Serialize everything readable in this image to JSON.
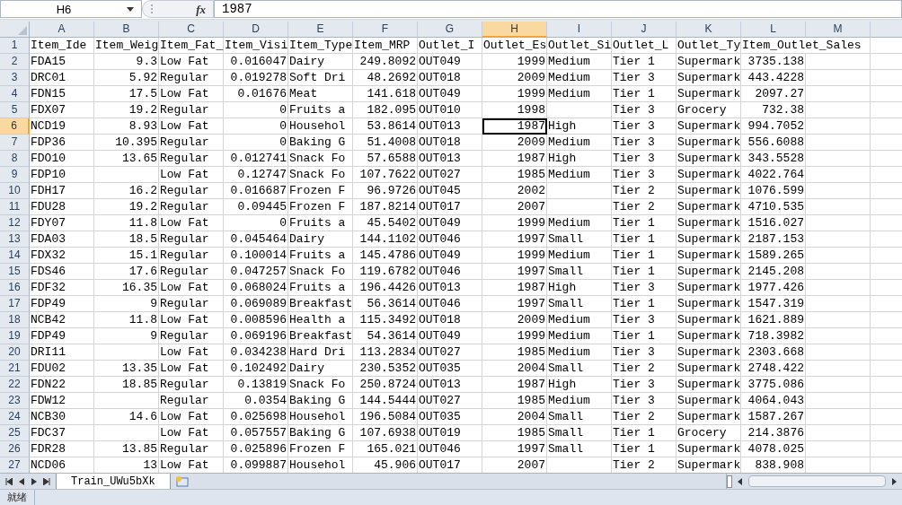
{
  "formula_bar": {
    "name_box": "H6",
    "function_label": "fx",
    "formula": "1987"
  },
  "columns": [
    {
      "letter": "A",
      "selected": false
    },
    {
      "letter": "B",
      "selected": false
    },
    {
      "letter": "C",
      "selected": false
    },
    {
      "letter": "D",
      "selected": false
    },
    {
      "letter": "E",
      "selected": false
    },
    {
      "letter": "F",
      "selected": false
    },
    {
      "letter": "G",
      "selected": false
    },
    {
      "letter": "H",
      "selected": true
    },
    {
      "letter": "I",
      "selected": false
    },
    {
      "letter": "J",
      "selected": false
    },
    {
      "letter": "K",
      "selected": false
    },
    {
      "letter": "L",
      "selected": false
    },
    {
      "letter": "M",
      "selected": false
    }
  ],
  "rows": [
    {
      "number": "1",
      "kind": "header",
      "selected": false,
      "cells": [
        "Item_Ide",
        "Item_Weig",
        "Item_Fat_",
        "Item_Visi",
        "Item_Type",
        "Item_MRP",
        "Outlet_I",
        "Outlet_Es",
        "Outlet_Si",
        "Outlet_L",
        "Outlet_Ty",
        "Item_Outlet_Sales",
        null
      ]
    },
    {
      "number": "2",
      "kind": "data",
      "selected": false,
      "cells": [
        "FDA15",
        "9.3",
        "Low Fat",
        "0.016047",
        "Dairy",
        "249.8092",
        "OUT049",
        "1999",
        "Medium",
        "Tier 1",
        "Supermark",
        "3735.138",
        null
      ]
    },
    {
      "number": "3",
      "kind": "data",
      "selected": false,
      "cells": [
        "DRC01",
        "5.92",
        "Regular",
        "0.019278",
        "Soft Dri",
        "48.2692",
        "OUT018",
        "2009",
        "Medium",
        "Tier 3",
        "Supermark",
        "443.4228",
        null
      ]
    },
    {
      "number": "4",
      "kind": "data",
      "selected": false,
      "cells": [
        "FDN15",
        "17.5",
        "Low Fat",
        "0.01676",
        "Meat",
        "141.618",
        "OUT049",
        "1999",
        "Medium",
        "Tier 1",
        "Supermark",
        "2097.27",
        null
      ]
    },
    {
      "number": "5",
      "kind": "data",
      "selected": false,
      "cells": [
        "FDX07",
        "19.2",
        "Regular",
        "0",
        "Fruits a",
        "182.095",
        "OUT010",
        "1998",
        null,
        "Tier 3",
        "Grocery",
        "732.38",
        null
      ]
    },
    {
      "number": "6",
      "kind": "data",
      "selected": true,
      "cells": [
        "NCD19",
        "8.93",
        "Low Fat",
        "0",
        "Househol",
        "53.8614",
        "OUT013",
        "1987",
        "High",
        "Tier 3",
        "Supermark",
        "994.7052",
        null
      ]
    },
    {
      "number": "7",
      "kind": "data",
      "selected": false,
      "cells": [
        "FDP36",
        "10.395",
        "Regular",
        "0",
        "Baking G",
        "51.4008",
        "OUT018",
        "2009",
        "Medium",
        "Tier 3",
        "Supermark",
        "556.6088",
        null
      ]
    },
    {
      "number": "8",
      "kind": "data",
      "selected": false,
      "cells": [
        "FDO10",
        "13.65",
        "Regular",
        "0.012741",
        "Snack Fo",
        "57.6588",
        "OUT013",
        "1987",
        "High",
        "Tier 3",
        "Supermark",
        "343.5528",
        null
      ]
    },
    {
      "number": "9",
      "kind": "data",
      "selected": false,
      "cells": [
        "FDP10",
        null,
        "Low Fat",
        "0.12747",
        "Snack Fo",
        "107.7622",
        "OUT027",
        "1985",
        "Medium",
        "Tier 3",
        "Supermark",
        "4022.764",
        null
      ]
    },
    {
      "number": "10",
      "kind": "data",
      "selected": false,
      "cells": [
        "FDH17",
        "16.2",
        "Regular",
        "0.016687",
        "Frozen F",
        "96.9726",
        "OUT045",
        "2002",
        null,
        "Tier 2",
        "Supermark",
        "1076.599",
        null
      ]
    },
    {
      "number": "11",
      "kind": "data",
      "selected": false,
      "cells": [
        "FDU28",
        "19.2",
        "Regular",
        "0.09445",
        "Frozen F",
        "187.8214",
        "OUT017",
        "2007",
        null,
        "Tier 2",
        "Supermark",
        "4710.535",
        null
      ]
    },
    {
      "number": "12",
      "kind": "data",
      "selected": false,
      "cells": [
        "FDY07",
        "11.8",
        "Low Fat",
        "0",
        "Fruits a",
        "45.5402",
        "OUT049",
        "1999",
        "Medium",
        "Tier 1",
        "Supermark",
        "1516.027",
        null
      ]
    },
    {
      "number": "13",
      "kind": "data",
      "selected": false,
      "cells": [
        "FDA03",
        "18.5",
        "Regular",
        "0.045464",
        "Dairy",
        "144.1102",
        "OUT046",
        "1997",
        "Small",
        "Tier 1",
        "Supermark",
        "2187.153",
        null
      ]
    },
    {
      "number": "14",
      "kind": "data",
      "selected": false,
      "cells": [
        "FDX32",
        "15.1",
        "Regular",
        "0.100014",
        "Fruits a",
        "145.4786",
        "OUT049",
        "1999",
        "Medium",
        "Tier 1",
        "Supermark",
        "1589.265",
        null
      ]
    },
    {
      "number": "15",
      "kind": "data",
      "selected": false,
      "cells": [
        "FDS46",
        "17.6",
        "Regular",
        "0.047257",
        "Snack Fo",
        "119.6782",
        "OUT046",
        "1997",
        "Small",
        "Tier 1",
        "Supermark",
        "2145.208",
        null
      ]
    },
    {
      "number": "16",
      "kind": "data",
      "selected": false,
      "cells": [
        "FDF32",
        "16.35",
        "Low Fat",
        "0.068024",
        "Fruits a",
        "196.4426",
        "OUT013",
        "1987",
        "High",
        "Tier 3",
        "Supermark",
        "1977.426",
        null
      ]
    },
    {
      "number": "17",
      "kind": "data",
      "selected": false,
      "cells": [
        "FDP49",
        "9",
        "Regular",
        "0.069089",
        "Breakfast",
        "56.3614",
        "OUT046",
        "1997",
        "Small",
        "Tier 1",
        "Supermark",
        "1547.319",
        null
      ]
    },
    {
      "number": "18",
      "kind": "data",
      "selected": false,
      "cells": [
        "NCB42",
        "11.8",
        "Low Fat",
        "0.008596",
        "Health a",
        "115.3492",
        "OUT018",
        "2009",
        "Medium",
        "Tier 3",
        "Supermark",
        "1621.889",
        null
      ]
    },
    {
      "number": "19",
      "kind": "data",
      "selected": false,
      "cells": [
        "FDP49",
        "9",
        "Regular",
        "0.069196",
        "Breakfast",
        "54.3614",
        "OUT049",
        "1999",
        "Medium",
        "Tier 1",
        "Supermark",
        "718.3982",
        null
      ]
    },
    {
      "number": "20",
      "kind": "data",
      "selected": false,
      "cells": [
        "DRI11",
        null,
        "Low Fat",
        "0.034238",
        "Hard Dri",
        "113.2834",
        "OUT027",
        "1985",
        "Medium",
        "Tier 3",
        "Supermark",
        "2303.668",
        null
      ]
    },
    {
      "number": "21",
      "kind": "data",
      "selected": false,
      "cells": [
        "FDU02",
        "13.35",
        "Low Fat",
        "0.102492",
        "Dairy",
        "230.5352",
        "OUT035",
        "2004",
        "Small",
        "Tier 2",
        "Supermark",
        "2748.422",
        null
      ]
    },
    {
      "number": "22",
      "kind": "data",
      "selected": false,
      "cells": [
        "FDN22",
        "18.85",
        "Regular",
        "0.13819",
        "Snack Fo",
        "250.8724",
        "OUT013",
        "1987",
        "High",
        "Tier 3",
        "Supermark",
        "3775.086",
        null
      ]
    },
    {
      "number": "23",
      "kind": "data",
      "selected": false,
      "cells": [
        "FDW12",
        null,
        "Regular",
        "0.0354",
        "Baking G",
        "144.5444",
        "OUT027",
        "1985",
        "Medium",
        "Tier 3",
        "Supermark",
        "4064.043",
        null
      ]
    },
    {
      "number": "24",
      "kind": "data",
      "selected": false,
      "cells": [
        "NCB30",
        "14.6",
        "Low Fat",
        "0.025698",
        "Househol",
        "196.5084",
        "OUT035",
        "2004",
        "Small",
        "Tier 2",
        "Supermark",
        "1587.267",
        null
      ]
    },
    {
      "number": "25",
      "kind": "data",
      "selected": false,
      "cells": [
        "FDC37",
        null,
        "Low Fat",
        "0.057557",
        "Baking G",
        "107.6938",
        "OUT019",
        "1985",
        "Small",
        "Tier 1",
        "Grocery",
        "214.3876",
        null
      ]
    },
    {
      "number": "26",
      "kind": "data",
      "selected": false,
      "cells": [
        "FDR28",
        "13.85",
        "Regular",
        "0.025896",
        "Frozen F",
        "165.021",
        "OUT046",
        "1997",
        "Small",
        "Tier 1",
        "Supermark",
        "4078.025",
        null
      ]
    },
    {
      "number": "27",
      "kind": "data",
      "selected": false,
      "cells": [
        "NCD06",
        "13",
        "Low Fat",
        "0.099887",
        "Househol",
        "45.906",
        "OUT017",
        "2007",
        null,
        "Tier 2",
        "Supermark",
        "838.908",
        null
      ]
    }
  ],
  "sheet_tabs": [
    {
      "label": "Train_UWu5bXk",
      "selected": true
    }
  ],
  "status_bar": {
    "text": "就绪"
  }
}
